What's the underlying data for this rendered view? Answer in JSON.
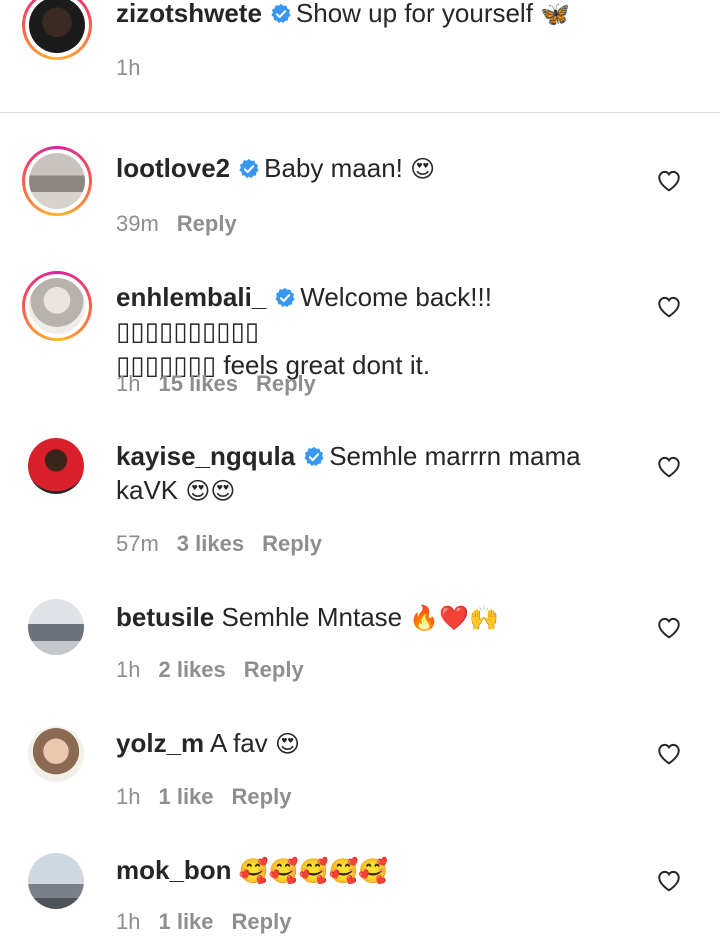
{
  "caption": {
    "username": "zizotshwete",
    "text": "Show up for yourself",
    "emoji": "🦋",
    "time": "1h"
  },
  "comments": [
    {
      "username": "lootlove2",
      "verified": true,
      "text": "Baby maan!",
      "emoji": "😍",
      "time": "39m",
      "likes": "",
      "reply": "Reply"
    },
    {
      "username": "enhlembali_",
      "verified": true,
      "text": "Welcome back!!! ▯▯▯▯▯▯▯▯▯▯",
      "text2": "▯▯▯▯▯▯▯ feels great dont it.",
      "time": "1h",
      "likes": "15 likes",
      "reply": "Reply"
    },
    {
      "username": "kayise_ngqula",
      "verified": true,
      "text": "Semhle marrrn mama",
      "text2": "kaVK",
      "emoji": "😍😍",
      "time": "57m",
      "likes": "3 likes",
      "reply": "Reply"
    },
    {
      "username": "betusile",
      "verified": false,
      "text": "Semhle Mntase",
      "emoji": "🔥❤️🙌",
      "time": "1h",
      "likes": "2 likes",
      "reply": "Reply"
    },
    {
      "username": "yolz_m",
      "verified": false,
      "text": "A fav",
      "emoji": "😍",
      "time": "1h",
      "likes": "1 like",
      "reply": "Reply"
    },
    {
      "username": "mok_bon",
      "verified": false,
      "text": "",
      "emoji": "🥰🥰🥰🥰🥰",
      "time": "1h",
      "likes": "1 like",
      "reply": "Reply"
    }
  ],
  "icons": {
    "verified": "verified-badge-icon",
    "like": "heart-outline-icon"
  },
  "colors": {
    "verified": "#3897f0",
    "meta": "#8e8e8e",
    "divider": "#dbdbdb"
  }
}
